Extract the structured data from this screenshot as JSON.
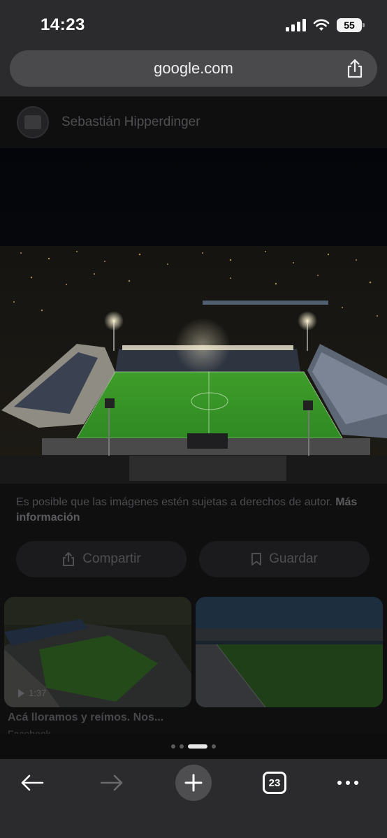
{
  "status_bar": {
    "time": "14:23",
    "battery": "55"
  },
  "browser": {
    "url": "google.com",
    "open_tabs": "23"
  },
  "image_viewer": {
    "author": "Sebastián Hipperdinger",
    "rights_notice": "Es posible que las imágenes estén sujetas a derechos de autor.",
    "rights_link": "Más información",
    "share_label": "Compartir",
    "save_label": "Guardar"
  },
  "related": [
    {
      "duration": "1:37",
      "title": "Acá lloramos y reímos. Nos...",
      "source": "Facebook"
    },
    {
      "duration": "",
      "title": "",
      "source": ""
    }
  ],
  "pagination": {
    "pages": 4,
    "active": 2
  },
  "icons": {
    "share": "share-icon",
    "bookmark": "bookmark-icon",
    "back": "arrow-left-icon",
    "forward": "arrow-right-icon",
    "new_tab": "plus-icon",
    "more": "more-horizontal-icon"
  }
}
